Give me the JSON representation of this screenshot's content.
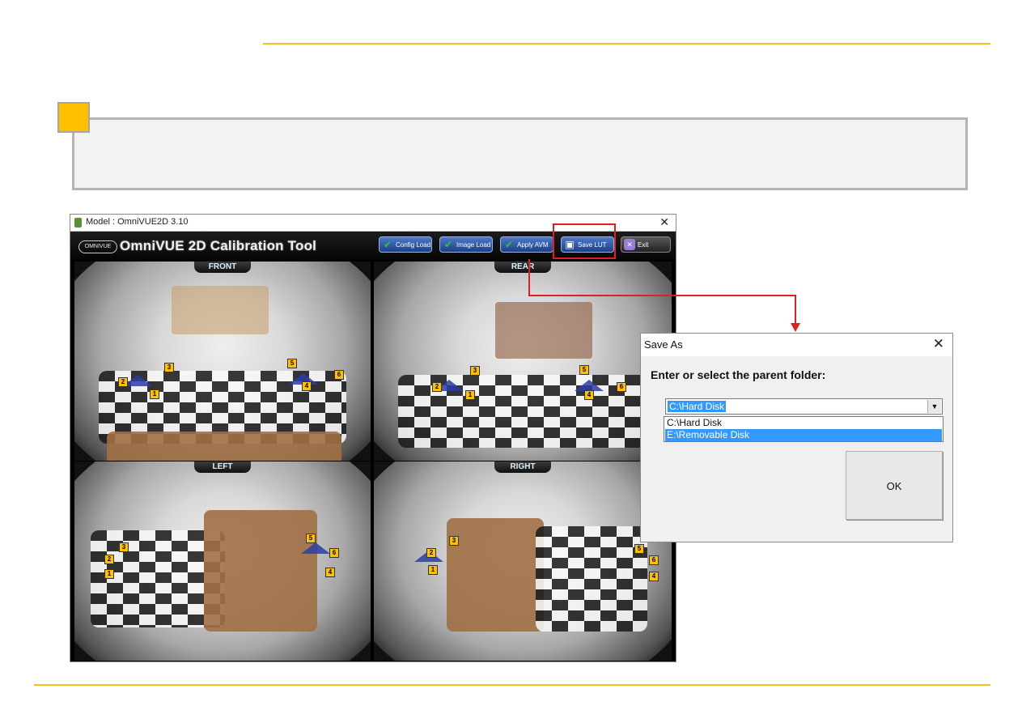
{
  "app": {
    "window_title": "Model : OmniVUE2D 3.10",
    "close_glyph": "✕",
    "logo_text": "OMNIVUE",
    "name": "OmniVUE 2D Calibration Tool",
    "toolbar": {
      "config_load": "Config Load",
      "image_load": "Image Load",
      "apply_avm": "Apply AVM",
      "save_lut": "Save LUT",
      "exit": "Exit"
    },
    "cameras": {
      "front": "FRONT",
      "rear": "REAR",
      "left": "LEFT",
      "right": "RIGHT"
    },
    "markers": [
      "1",
      "2",
      "3",
      "4",
      "5",
      "6"
    ]
  },
  "dialog": {
    "title": "Save As",
    "close_glyph": "✕",
    "prompt": "Enter or select the parent folder:",
    "selected_value": "C:\\Hard Disk",
    "dropdown_glyph": "▼",
    "options": [
      "C:\\Hard Disk",
      "E:\\Removable Disk"
    ],
    "highlighted_option": "E:\\Removable Disk",
    "ok_label": "OK"
  },
  "colors": {
    "accent_gold": "#f2c418",
    "note_square": "#ffc000",
    "highlight_red": "#e02020",
    "selection_blue": "#3399ff"
  }
}
